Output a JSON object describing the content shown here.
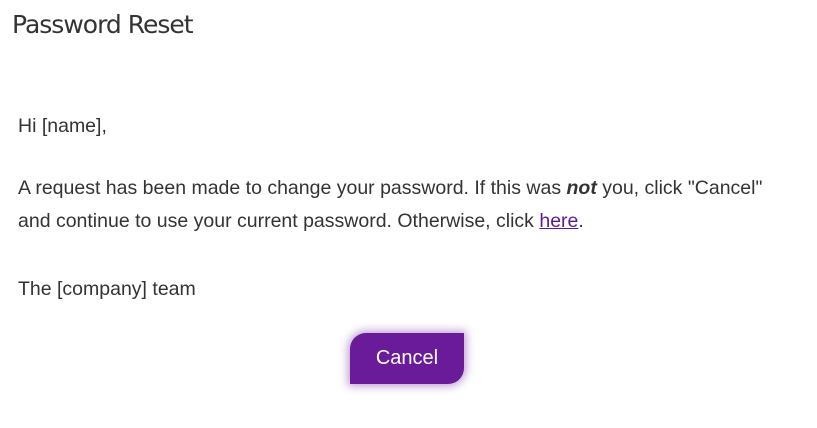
{
  "page": {
    "title": "Password Reset"
  },
  "email": {
    "greeting": "Hi [name],",
    "message_part1": "A request has been made to change your password. If this was ",
    "message_emphasis": "not",
    "message_part2": " you, click \"Cancel\" and continue to use your current password. Otherwise, click ",
    "link_text": "here",
    "message_end": ".",
    "signoff": "The [company] team"
  },
  "actions": {
    "cancel_label": "Cancel"
  },
  "colors": {
    "accent": "#6a1b9a",
    "link": "#5c1a9a",
    "text": "#333333"
  }
}
